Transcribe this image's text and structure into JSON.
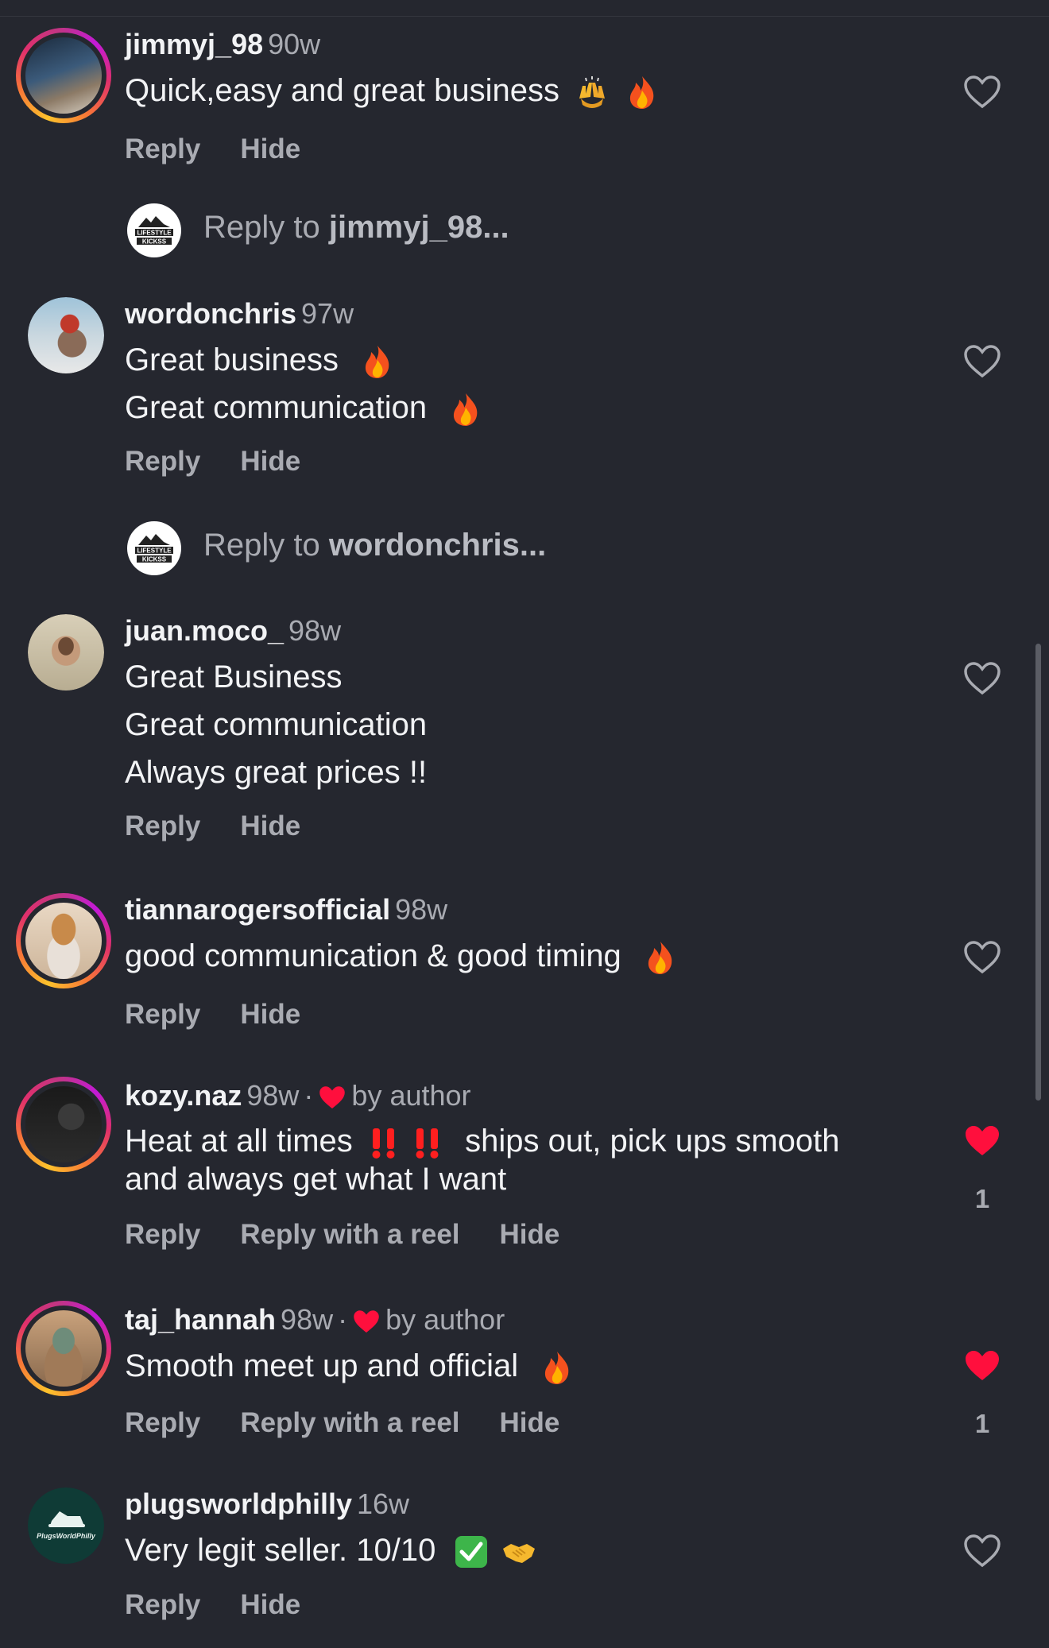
{
  "comments": [
    {
      "user": "jimmyj_98",
      "time": "90w",
      "line1": "Quick,easy and great business",
      "actions": [
        "Reply",
        "Hide"
      ]
    },
    {
      "user": "wordonchris",
      "time": "97w",
      "line1": "Great business",
      "line2": "Great communication",
      "actions": [
        "Reply",
        "Hide"
      ]
    },
    {
      "user": "juan.moco_",
      "time": "98w",
      "line1": "Great Business",
      "line2": "Great communication",
      "line3": "Always great prices !!",
      "actions": [
        "Reply",
        "Hide"
      ]
    },
    {
      "user": "tiannarogersofficial",
      "time": "98w",
      "line1": "good communication & good timing",
      "actions": [
        "Reply",
        "Hide"
      ]
    },
    {
      "user": "kozy.naz",
      "time": "98w",
      "byauthor": "by author",
      "line1a": "Heat at all times",
      "line1b": "ships out, pick ups smooth",
      "line2": "and always get what I want",
      "likes": "1",
      "actions": [
        "Reply",
        "Reply with a reel",
        "Hide"
      ]
    },
    {
      "user": "taj_hannah",
      "time": "98w",
      "byauthor": "by author",
      "line1": "Smooth meet up and official",
      "likes": "1",
      "actions": [
        "Reply",
        "Reply with a reel",
        "Hide"
      ]
    },
    {
      "user": "plugsworldphilly",
      "time": "16w",
      "line1": "Very legit seller. 10/10",
      "actions": [
        "Reply",
        "Hide"
      ]
    }
  ],
  "reply_rows": [
    {
      "prefix": "Reply to",
      "user": "jimmyj_98...",
      "logo_text": "LIFESTYLE KICKSS"
    },
    {
      "prefix": "Reply to",
      "user": "wordonchris...",
      "logo_text": "LIFESTYLE KICKSS"
    }
  ],
  "avatar_labels": {
    "plugsworldphilly": "PlugsWorldPhilly"
  },
  "separator": "·",
  "colors": {
    "background": "#25272f",
    "muted": "#a9abb2",
    "like_red": "#ff0f3d",
    "text": "#f2f3f5"
  },
  "icons": [
    "heart-outline-icon",
    "heart-filled-icon",
    "fire-emoji",
    "raised-hands-emoji",
    "double-exclamation-emoji",
    "check-mark-emoji",
    "handshake-emoji"
  ]
}
